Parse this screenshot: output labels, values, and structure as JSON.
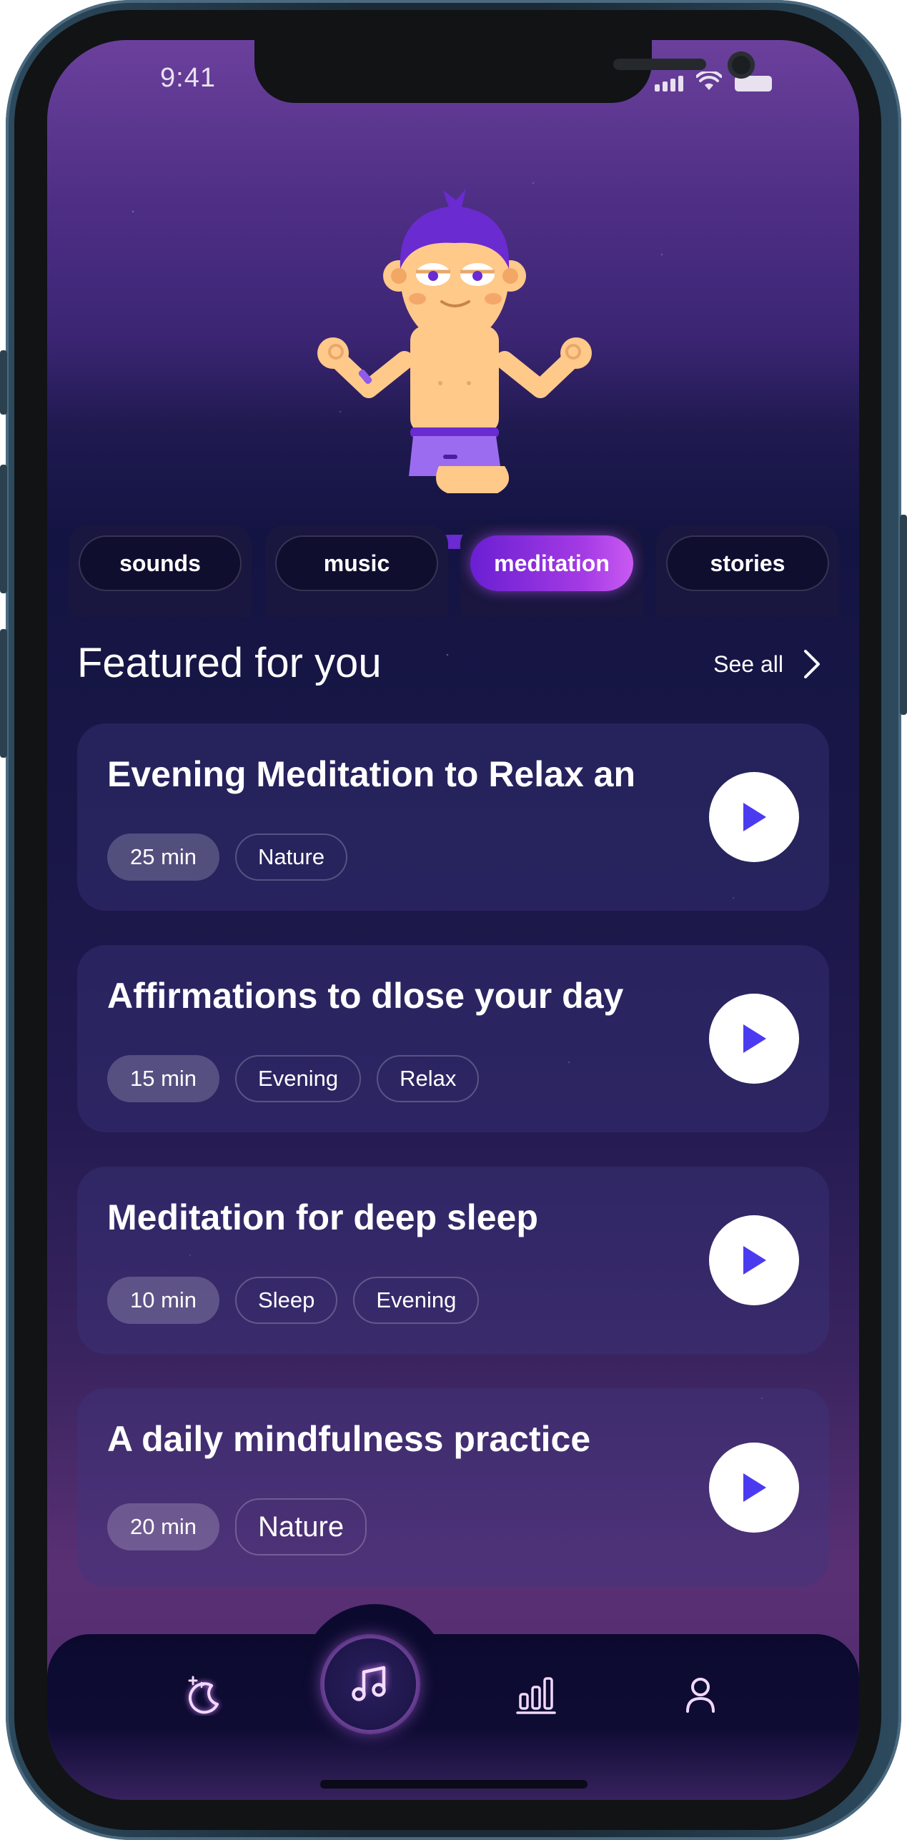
{
  "status_bar": {
    "time": "9:41"
  },
  "tabs": [
    {
      "label": "sounds",
      "active": false
    },
    {
      "label": "music",
      "active": false
    },
    {
      "label": "meditation",
      "active": true
    },
    {
      "label": "stories",
      "active": false
    }
  ],
  "featured": {
    "title": "Featured for you",
    "see_all": "See all",
    "cards": [
      {
        "title": "Evening Meditation to Relax an",
        "duration": "25 min",
        "tags": [
          "Nature"
        ]
      },
      {
        "title": "Affirmations to dlose your day",
        "duration": "15 min",
        "tags": [
          "Evening",
          "Relax"
        ]
      },
      {
        "title": "Meditation for deep sleep",
        "duration": "10 min",
        "tags": [
          "Sleep",
          "Evening"
        ]
      },
      {
        "title": "A daily mindfulness practice",
        "duration": "20 min",
        "tags": [
          "Nature"
        ]
      }
    ]
  },
  "nav": {
    "items": [
      {
        "icon": "moon-stars-icon"
      },
      {
        "icon": "music-note-icon",
        "active": true
      },
      {
        "icon": "bar-chart-icon"
      },
      {
        "icon": "profile-icon"
      }
    ]
  },
  "colors": {
    "accent_purple": "#8a2be2",
    "play_triangle": "#4b3bf0",
    "background_top": "#6b409c",
    "background_mid": "#141443"
  }
}
